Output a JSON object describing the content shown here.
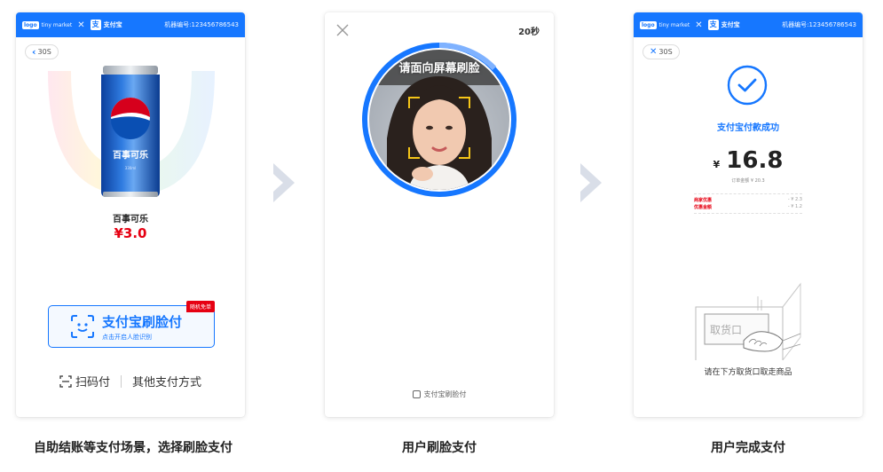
{
  "screens": [
    {
      "topbar": {
        "logo_text": "logo",
        "market_text": "tiny market",
        "separator": "✕",
        "alipay_icon_char": "支",
        "alipay_text": "支付宝",
        "machine_no": "机器编号:123456786543"
      },
      "back_label": "30S",
      "product": {
        "name": "百事可乐",
        "price": "¥3.0"
      },
      "face_pay": {
        "badge": "随机免单",
        "title": "支付宝刷脸付",
        "subtitle": "点击开启人脸识别"
      },
      "links": {
        "scan": "扫码付",
        "other": "其他支付方式"
      },
      "caption": "自助结账等支付场景，选择刷脸支付"
    },
    {
      "countdown": "20秒",
      "hint": "请面向屏幕刷脸",
      "footer": "支付宝刷脸付",
      "caption": "用户刷脸支付"
    },
    {
      "topbar": {
        "logo_text": "logo",
        "market_text": "tiny market",
        "separator": "✕",
        "alipay_icon_char": "支",
        "alipay_text": "支付宝",
        "machine_no": "机器编号:123456786543"
      },
      "back_label": "30S",
      "success_title": "支付宝付款成功",
      "amount": {
        "currency": "¥",
        "value": "16.8"
      },
      "order_amount": "订单金额 ¥ 20.3",
      "discounts": [
        {
          "label": "商家优惠",
          "value": "- ¥ 2.3"
        },
        {
          "label": "优惠金额",
          "value": "- ¥ 1.2"
        }
      ],
      "pickup_label": "取货口",
      "pickup_text": "请在下方取货口取走商品",
      "caption": "用户完成支付"
    }
  ],
  "colors": {
    "primary_blue": "#1677ff",
    "price_red": "#e60012",
    "arrow_gray": "#d9dee8"
  },
  "icons": [
    "chevron-left-icon",
    "close-icon",
    "face-scan-icon",
    "scan-code-icon",
    "check-icon",
    "chevron-right-icon"
  ]
}
